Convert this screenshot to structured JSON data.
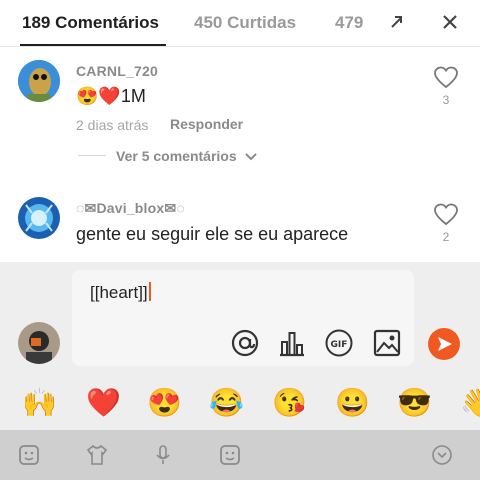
{
  "tabs": {
    "comments": "189 Comentários",
    "likes": "450 Curtidas",
    "third": "479"
  },
  "comments": [
    {
      "username": "CARNL_720",
      "text_suffix": "1M",
      "emoji_1": "😍",
      "emoji_2": "❤️",
      "time": "2 dias atrás",
      "reply_label": "Responder",
      "more_label": "Ver 5 comentários",
      "likes": "3"
    },
    {
      "username": "◌✉Davi_blox✉◌",
      "text": "gente eu seguir ele se eu aparece",
      "likes": "2"
    }
  ],
  "input": {
    "value": "[[heart]]"
  },
  "emojis": [
    "🙌",
    "❤️",
    "😍",
    "😂",
    "😘",
    "😀",
    "😎",
    "👋"
  ],
  "colors": {
    "accent": "#f05a22",
    "heart": "#e0202a"
  }
}
